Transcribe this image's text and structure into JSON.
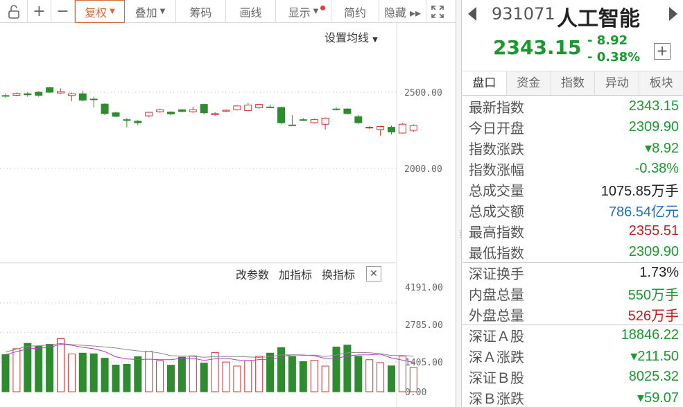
{
  "toolbar": {
    "lock_icon": "lock-icon",
    "zoom_in": "+",
    "zoom_out": "−",
    "items": [
      {
        "label": "复权",
        "dropdown": true,
        "active": true
      },
      {
        "label": "叠加",
        "dropdown": true
      },
      {
        "label": "筹码"
      },
      {
        "label": "画线"
      },
      {
        "label": "显示",
        "dropdown": true,
        "dot": true
      },
      {
        "label": "简约"
      },
      {
        "label": "隐藏 ▸▸"
      }
    ],
    "fullscreen_icon": "fullscreen-icon"
  },
  "chart": {
    "ma_settings": "设置均线",
    "price_axis": [
      "2500.00",
      "2000.00"
    ],
    "indicator_buttons": [
      "改参数",
      "加指标",
      "换指标"
    ],
    "volume_axis": [
      "4191.00",
      "2785.00",
      "1405.00",
      "0.00"
    ]
  },
  "chart_data": {
    "type": "candlestick",
    "colors": {
      "up": "#d43030",
      "down": "#2e8b30",
      "ma": "#b43cc8",
      "ma2": "#888888"
    },
    "price_ticks": [
      2500,
      2000
    ],
    "candles": [
      {
        "o": 2478,
        "c": 2478,
        "h": 2492,
        "l": 2465
      },
      {
        "o": 2480,
        "c": 2492,
        "h": 2498,
        "l": 2474
      },
      {
        "o": 2490,
        "c": 2483,
        "h": 2502,
        "l": 2470
      },
      {
        "o": 2500,
        "c": 2480,
        "h": 2508,
        "l": 2470
      },
      {
        "o": 2530,
        "c": 2500,
        "h": 2535,
        "l": 2495
      },
      {
        "o": 2495,
        "c": 2505,
        "h": 2525,
        "l": 2488
      },
      {
        "o": 2478,
        "c": 2490,
        "h": 2497,
        "l": 2440
      },
      {
        "o": 2490,
        "c": 2448,
        "h": 2510,
        "l": 2440
      },
      {
        "o": 2455,
        "c": 2455,
        "h": 2470,
        "l": 2400
      },
      {
        "o": 2422,
        "c": 2360,
        "h": 2428,
        "l": 2350
      },
      {
        "o": 2365,
        "c": 2342,
        "h": 2372,
        "l": 2335
      },
      {
        "o": 2320,
        "c": 2320,
        "h": 2330,
        "l": 2270
      },
      {
        "o": 2310,
        "c": 2300,
        "h": 2318,
        "l": 2285
      },
      {
        "o": 2345,
        "c": 2368,
        "h": 2372,
        "l": 2338
      },
      {
        "o": 2372,
        "c": 2385,
        "h": 2392,
        "l": 2366
      },
      {
        "o": 2370,
        "c": 2358,
        "h": 2375,
        "l": 2350
      },
      {
        "o": 2385,
        "c": 2374,
        "h": 2390,
        "l": 2368
      },
      {
        "o": 2372,
        "c": 2385,
        "h": 2405,
        "l": 2365
      },
      {
        "o": 2420,
        "c": 2365,
        "h": 2425,
        "l": 2355
      },
      {
        "o": 2353,
        "c": 2360,
        "h": 2368,
        "l": 2345
      },
      {
        "o": 2376,
        "c": 2382,
        "h": 2386,
        "l": 2370
      },
      {
        "o": 2385,
        "c": 2410,
        "h": 2415,
        "l": 2380
      },
      {
        "o": 2380,
        "c": 2416,
        "h": 2430,
        "l": 2375
      },
      {
        "o": 2398,
        "c": 2420,
        "h": 2424,
        "l": 2390
      },
      {
        "o": 2403,
        "c": 2400,
        "h": 2418,
        "l": 2395
      },
      {
        "o": 2400,
        "c": 2300,
        "h": 2405,
        "l": 2290
      },
      {
        "o": 2285,
        "c": 2285,
        "h": 2350,
        "l": 2280
      },
      {
        "o": 2320,
        "c": 2318,
        "h": 2330,
        "l": 2310
      },
      {
        "o": 2300,
        "c": 2320,
        "h": 2328,
        "l": 2295
      },
      {
        "o": 2290,
        "c": 2330,
        "h": 2335,
        "l": 2255
      },
      {
        "o": 2390,
        "c": 2390,
        "h": 2402,
        "l": 2380
      },
      {
        "o": 2390,
        "c": 2360,
        "h": 2395,
        "l": 2355
      },
      {
        "o": 2340,
        "c": 2300,
        "h": 2350,
        "l": 2290
      },
      {
        "o": 2268,
        "c": 2270,
        "h": 2278,
        "l": 2260
      },
      {
        "o": 2255,
        "c": 2275,
        "h": 2280,
        "l": 2215
      },
      {
        "o": 2270,
        "c": 2240,
        "h": 2282,
        "l": 2225
      },
      {
        "o": 2232,
        "c": 2290,
        "h": 2298,
        "l": 2228
      },
      {
        "o": 2250,
        "c": 2282,
        "h": 2290,
        "l": 2240
      }
    ],
    "volumes": [
      1750,
      2030,
      2280,
      2140,
      2240,
      2500,
      1780,
      1820,
      1790,
      1580,
      1260,
      1290,
      1650,
      1900,
      1460,
      1250,
      1630,
      1690,
      1350,
      1850,
      1400,
      1210,
      1460,
      1670,
      1820,
      2080,
      1670,
      1420,
      1480,
      1210,
      2110,
      2200,
      1670,
      1510,
      1370,
      1220,
      1680,
      1140
    ],
    "volume_ticks": [
      4191,
      2785,
      1405,
      0
    ]
  },
  "panel": {
    "code": "931071",
    "name": "人工智能",
    "price": "2343.15",
    "change": "- 8.92",
    "change_pct": "- 0.38%",
    "add_btn": "+",
    "tabs": [
      "盘口",
      "资金",
      "指数",
      "异动",
      "板块"
    ],
    "rows": [
      {
        "label": "最新指数",
        "value": "2343.15",
        "color": "green"
      },
      {
        "label": "今日开盘",
        "value": "2309.90",
        "color": "green"
      },
      {
        "label": "指数涨跌",
        "value": "▾8.92",
        "color": "green"
      },
      {
        "label": "指数涨幅",
        "value": "-0.38%",
        "color": "green"
      },
      {
        "label": "总成交量",
        "value": "1075.85万手",
        "color": "dark"
      },
      {
        "label": "总成交额",
        "value": "786.54亿元",
        "color": "blue"
      },
      {
        "label": "最高指数",
        "value": "2355.51",
        "color": "red"
      },
      {
        "label": "最低指数",
        "value": "2309.90",
        "color": "green"
      },
      {
        "label": "深证换手",
        "value": "1.73%",
        "color": "dark",
        "sep": true
      },
      {
        "label": "内盘总量",
        "value": "550万手",
        "color": "green"
      },
      {
        "label": "外盘总量",
        "value": "526万手",
        "color": "red"
      },
      {
        "label": "深证Ａ股",
        "value": "18846.22",
        "color": "green",
        "sep": true
      },
      {
        "label": "深Ａ涨跌",
        "value": "▾211.50",
        "color": "green"
      },
      {
        "label": "深证Ｂ股",
        "value": "8025.32",
        "color": "green"
      },
      {
        "label": "深Ｂ涨跌",
        "value": "▾59.07",
        "color": "green"
      }
    ]
  }
}
